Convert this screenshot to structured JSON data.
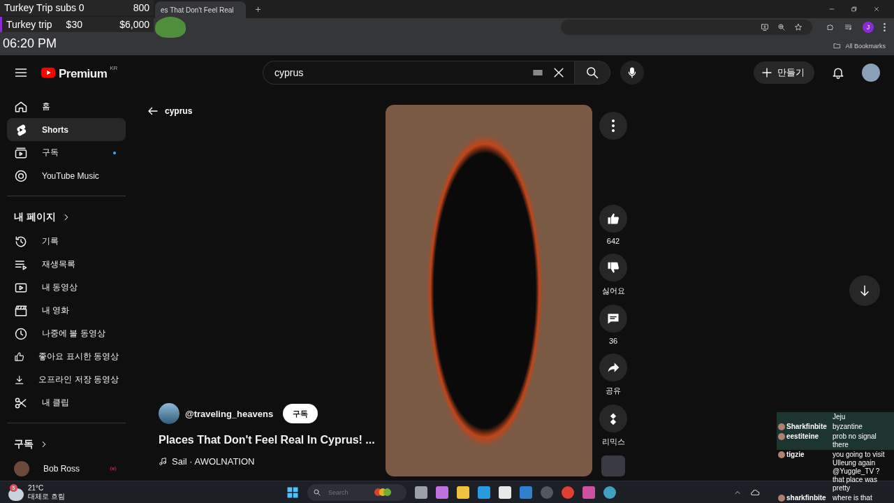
{
  "stream_overlay": {
    "goal_rows": [
      {
        "cells": [
          "Turkey Trip subs 0",
          "800"
        ]
      },
      {
        "cells": [
          "Turkey trip",
          "$30",
          "$6,000"
        ]
      }
    ],
    "clock": "06:20 PM"
  },
  "browser": {
    "tab_title": "es That Don't Feel Real",
    "profile_initial": "J",
    "bookmarks": "All Bookmarks"
  },
  "header": {
    "logo": "Premium",
    "region": "KR",
    "search": {
      "value": "cyprus"
    },
    "create": "만들기"
  },
  "sidebar": {
    "main_items": [
      {
        "label": "홈",
        "selected": false,
        "new_content": false
      },
      {
        "label": "Shorts",
        "selected": true,
        "new_content": false
      },
      {
        "label": "구독",
        "selected": false,
        "new_content": true
      },
      {
        "label": "YouTube Music",
        "selected": false,
        "new_content": false
      }
    ],
    "my_page": {
      "title": "내 페이지",
      "items": [
        {
          "label": "기록",
          "selected": false
        },
        {
          "label": "재생목록",
          "selected": false
        },
        {
          "label": "내 동영상",
          "selected": false
        },
        {
          "label": "내 영화",
          "selected": false
        },
        {
          "label": "나중에 볼 동영상",
          "selected": false
        },
        {
          "label": "좋아요 표시한 동영상",
          "selected": false
        },
        {
          "label": "오프라인 저장 동영상",
          "selected": false
        },
        {
          "label": "내 클립",
          "selected": false
        }
      ]
    },
    "subscriptions": {
      "title": "구독",
      "channels": [
        {
          "name": "Bob Ross",
          "live": true
        }
      ]
    }
  },
  "short": {
    "back_label": "cyprus",
    "channel": "@traveling_heavens",
    "subscribe": "구독",
    "title": "Places That Don't Feel Real In Cyprus! ...",
    "music": "Sail · AWOLNATION",
    "actions": [
      {
        "label": "642"
      },
      {
        "label": "싫어요"
      },
      {
        "label": "36"
      },
      {
        "label": "공유"
      },
      {
        "label": "리믹스"
      }
    ]
  },
  "chat": {
    "messages": [
      {
        "text": "Jeju",
        "highlighted": true
      },
      {
        "user": "Sharkfinbite",
        "text": "byzantine",
        "highlighted": true
      },
      {
        "user": "eestiteine",
        "text": "prob no signal there",
        "highlighted": true
      },
      {
        "user": "tigzie",
        "text": "you going to visit Ulleung again @Yuggle_TV ? that place was pretty",
        "highlighted": false
      },
      {
        "user": "sharkfinbite",
        "text": "where is that",
        "highlighted": false
      }
    ]
  },
  "taskbar": {
    "weather": {
      "badge": "5",
      "temperature": "21°C",
      "condition": "대체로 흐림"
    },
    "search_placeholder": "Search"
  }
}
